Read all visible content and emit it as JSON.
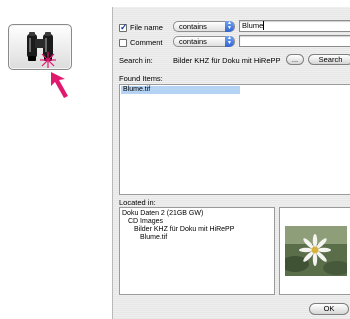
{
  "criteria": {
    "filename": {
      "label": "File name",
      "checked": true,
      "operator": "contains",
      "value": "Blume"
    },
    "comment": {
      "label": "Comment",
      "checked": false,
      "operator": "contains",
      "value": ""
    }
  },
  "search": {
    "label": "Search in:",
    "location": "Bilder KHZ für Doku mit HiRePP",
    "browse_label": "...",
    "button_label": "Search"
  },
  "found": {
    "label": "Found Items:",
    "items": [
      "Blume.tif"
    ]
  },
  "located": {
    "label": "Located in:",
    "path": [
      "Doku Daten 2 (21GB GW)",
      "CD Images",
      "Bilder KHZ für Doku mit HiRePP",
      "Blume.tif"
    ]
  },
  "ok_label": "OK",
  "colors": {
    "selection": "#b5d3f5",
    "accent_arrow": "#e0196e",
    "popup_arrows": "#2f63d2"
  }
}
